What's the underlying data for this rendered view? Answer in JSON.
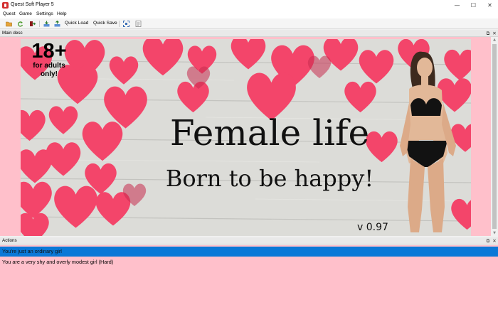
{
  "window": {
    "title": "Quest Soft Player 5",
    "minimize_glyph": "—",
    "maximize_glyph": "☐",
    "close_glyph": "✕"
  },
  "menu": [
    "Quest",
    "Game",
    "Settings",
    "Help"
  ],
  "toolbar": {
    "icons": [
      "open-folder-icon",
      "reload-icon",
      "exit-icon",
      "load-icon",
      "save-icon",
      "fullscreen-icon",
      "info-icon"
    ],
    "quick_load": "Quick Load",
    "quick_save": "Quick Save"
  },
  "main_panel": {
    "title": "Main desc",
    "undock_glyph": "⧉",
    "close_glyph": "✕",
    "scroll_up_glyph": "▲",
    "scroll_down_glyph": "▼",
    "banner": {
      "rating": "18+",
      "rating_sub_1": "for adults",
      "rating_sub_2": "only!",
      "title": "Female life",
      "subtitle": "Born to be happy!",
      "version": "v 0.97"
    }
  },
  "actions_panel": {
    "title": "Actions",
    "undock_glyph": "⧉",
    "close_glyph": "✕",
    "items": [
      {
        "label": "You're just an ordinary girl",
        "selected": true
      },
      {
        "label": "You are a very shy and overly modest girl (Hard)",
        "selected": false
      }
    ]
  },
  "colors": {
    "panel_background": "#ffc0cb",
    "selection": "#0a78d7",
    "heart": "#f3456a",
    "wood": "#dcdcd8"
  }
}
